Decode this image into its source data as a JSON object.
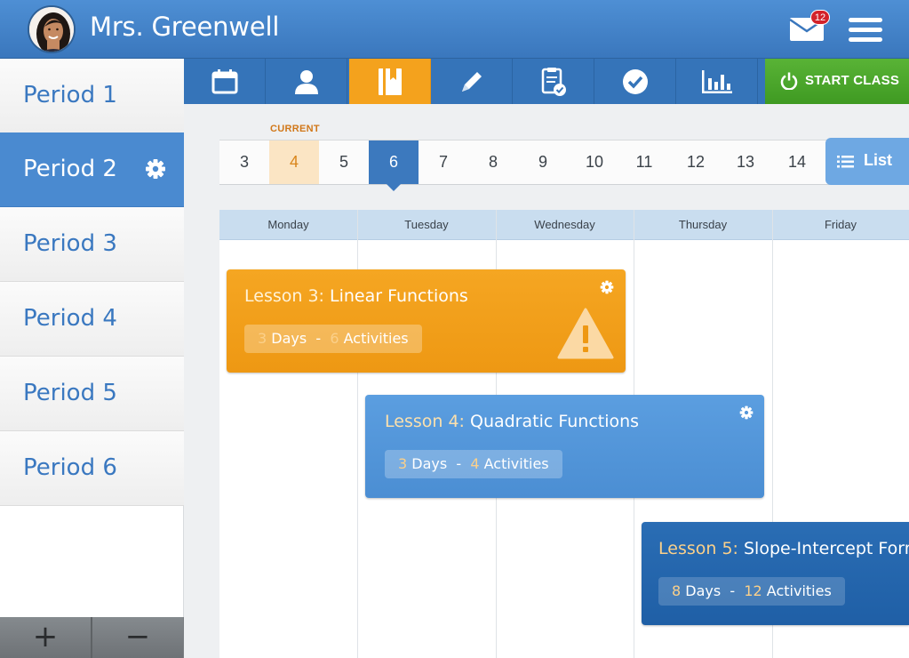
{
  "header": {
    "teacher_name": "Mrs. Greenwell",
    "mail_badge": "12",
    "icons": [
      "avatar",
      "mail-icon",
      "hamburger-menu-icon"
    ]
  },
  "sidebar": {
    "periods": [
      {
        "label": "Period 1",
        "active": false
      },
      {
        "label": "Period 2",
        "active": true
      },
      {
        "label": "Period 3",
        "active": false
      },
      {
        "label": "Period 4",
        "active": false
      },
      {
        "label": "Period 5",
        "active": false
      },
      {
        "label": "Period 6",
        "active": false
      }
    ],
    "add_label": "+",
    "remove_label": "−"
  },
  "toolbar": {
    "tools": [
      "calendar-icon",
      "student-icon",
      "book-icon",
      "pencil-icon",
      "clipboard-check-icon",
      "checkmark-icon",
      "bar-chart-icon"
    ],
    "active_tool": "book-icon",
    "start_label": "START CLASS"
  },
  "day_strip": {
    "current_label": "CURRENT",
    "days": [
      "3",
      "4",
      "5",
      "6",
      "7",
      "8",
      "9",
      "10",
      "11",
      "12",
      "13",
      "14"
    ],
    "current_day": "4",
    "selected_day": "6",
    "list_label": "List"
  },
  "week": {
    "days": [
      "Monday",
      "Tuesday",
      "Wednesday",
      "Thursday",
      "Friday"
    ]
  },
  "lessons": [
    {
      "prefix": "Lesson 3:",
      "name": "Linear Functions",
      "days": "3",
      "days_label": "Days",
      "sep": "-",
      "activities": "6",
      "activities_label": "Activities",
      "color": "#f29e1b",
      "warning": true
    },
    {
      "prefix": "Lesson 4:",
      "name": "Quadratic Functions",
      "days": "3",
      "days_label": "Days",
      "sep": "-",
      "activities": "4",
      "activities_label": "Activities",
      "color": "#5597da",
      "warning": false
    },
    {
      "prefix": "Lesson 5:",
      "name": "Slope-Intercept Form",
      "days": "8",
      "days_label": "Days",
      "sep": "-",
      "activities": "12",
      "activities_label": "Activities",
      "color": "#2566ad",
      "warning": false
    }
  ],
  "colors": {
    "header_blue": "#3a77bd",
    "accent_orange": "#f4a21d",
    "start_green": "#4aa42b"
  }
}
